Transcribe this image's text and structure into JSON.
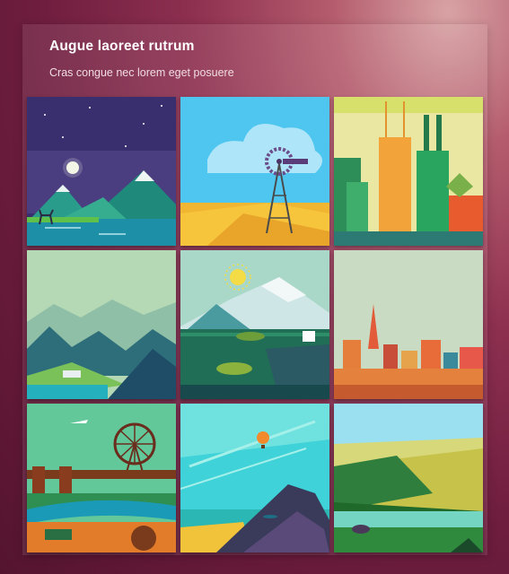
{
  "card": {
    "title": "Augue laoreet rutrum",
    "subtitle": "Cras congue nec lorem eget posuere"
  },
  "colors": {
    "background": "#7a2446",
    "panel": "rgba(255,255,255,0.09)",
    "title": "#ffffff",
    "subtitle": "#f1dce2"
  },
  "gallery": {
    "tiles": [
      {
        "icon": "night-mountains-image"
      },
      {
        "icon": "windmill-field-image"
      },
      {
        "icon": "city-skyscrapers-image"
      },
      {
        "icon": "misty-valley-image"
      },
      {
        "icon": "seattle-mountain-image"
      },
      {
        "icon": "san-francisco-image"
      },
      {
        "icon": "london-ferris-wheel-image"
      },
      {
        "icon": "beach-cliffs-balloon-image"
      },
      {
        "icon": "forest-bear-image"
      }
    ]
  }
}
